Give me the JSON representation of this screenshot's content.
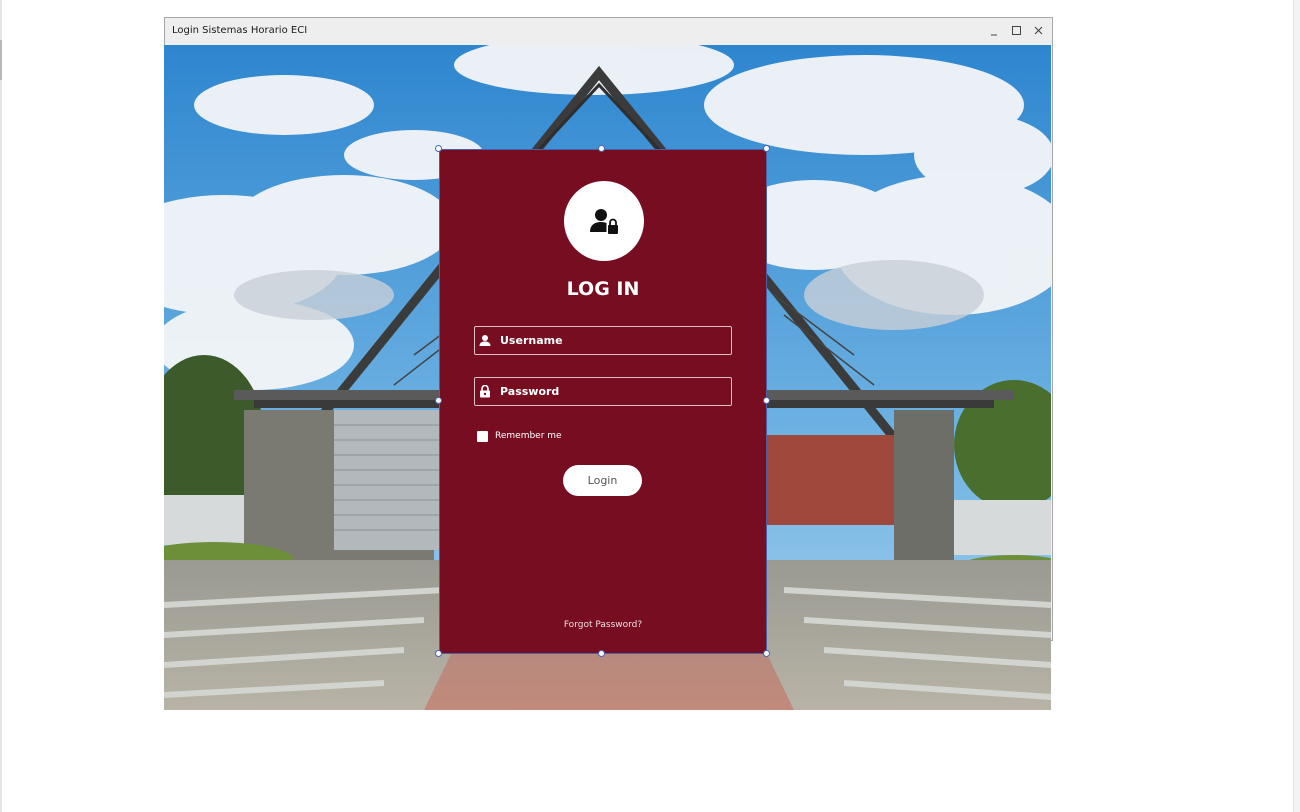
{
  "window": {
    "title": "Login Sistemas Horario ECI",
    "controls": [
      "minimize-icon",
      "maximize-icon",
      "close-icon"
    ]
  },
  "login": {
    "avatar_icon": "user-lock-icon",
    "title": "LOG IN",
    "username_placeholder": "Username",
    "username_icon": "user-icon",
    "password_placeholder": "Password",
    "password_icon": "lock-icon",
    "remember_label": "Remember me",
    "remember_checked": false,
    "login_button": "Login",
    "forgot_link": "Forgot Password?"
  },
  "colors": {
    "panel": "#760d20",
    "text": "#ffffff",
    "selection_border": "#4a66b5"
  }
}
